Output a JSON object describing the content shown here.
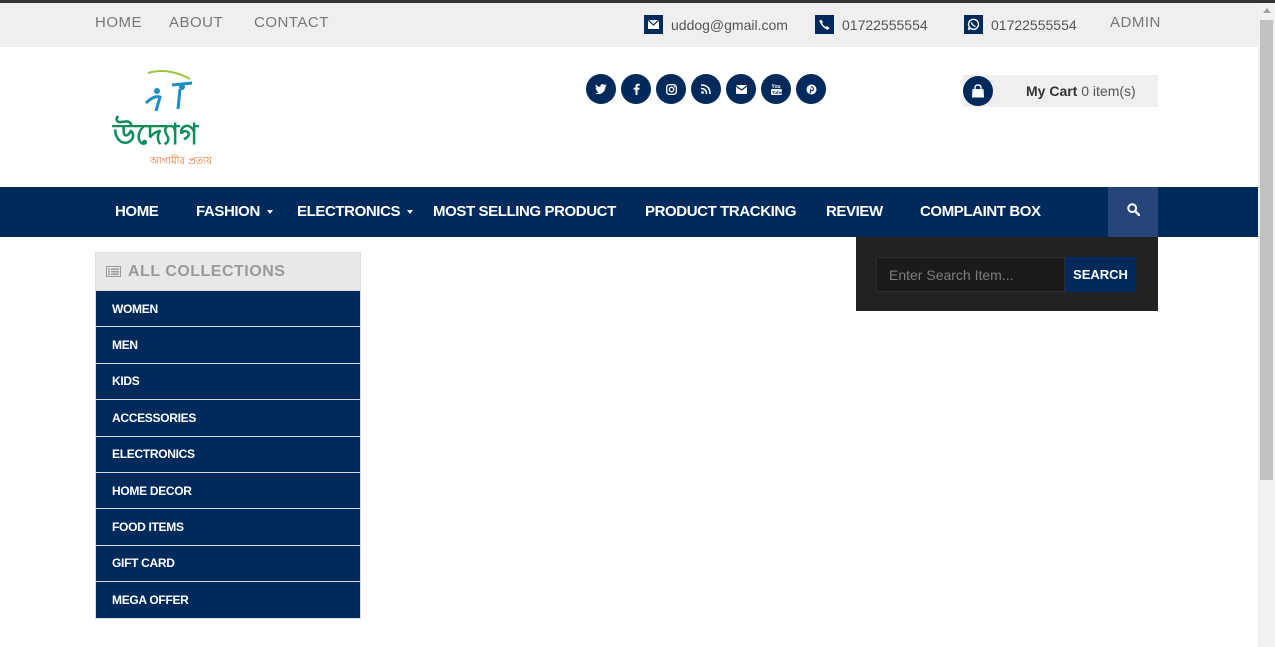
{
  "topbar": {
    "links": [
      "HOME",
      "ABOUT",
      "CONTACT"
    ],
    "email": "uddog@gmail.com",
    "phone": "01722555554",
    "whatsapp": "01722555554",
    "admin": "ADMIN"
  },
  "logo": {
    "text": "উদ্যোগ",
    "tagline": "আগামীর প্রত্যয়"
  },
  "social": [
    "twitter-icon",
    "facebook-icon",
    "instagram-icon",
    "rss-icon",
    "envelope-icon",
    "youtube-icon",
    "pinterest-icon"
  ],
  "cart": {
    "label": "My Cart",
    "count": "0 item(s)"
  },
  "nav": {
    "items": [
      "HOME",
      "FASHION",
      "ELECTRONICS",
      "MOST SELLING PRODUCT",
      "PRODUCT TRACKING",
      "REVIEW",
      "COMPLAINT BOX"
    ]
  },
  "search": {
    "placeholder": "Enter Search Item...",
    "button": "SEARCH"
  },
  "collections": {
    "title": "ALL COLLECTIONS",
    "items": [
      "WOMEN",
      "MEN",
      "KIDS",
      "ACCESSORIES",
      "ELECTRONICS",
      "HOME DECOR",
      "FOOD ITEMS",
      "GIFT CARD",
      "MEGA OFFER"
    ]
  },
  "colors": {
    "primary": "#002a5c",
    "topbar": "#efefef",
    "search_panel": "#222222"
  }
}
